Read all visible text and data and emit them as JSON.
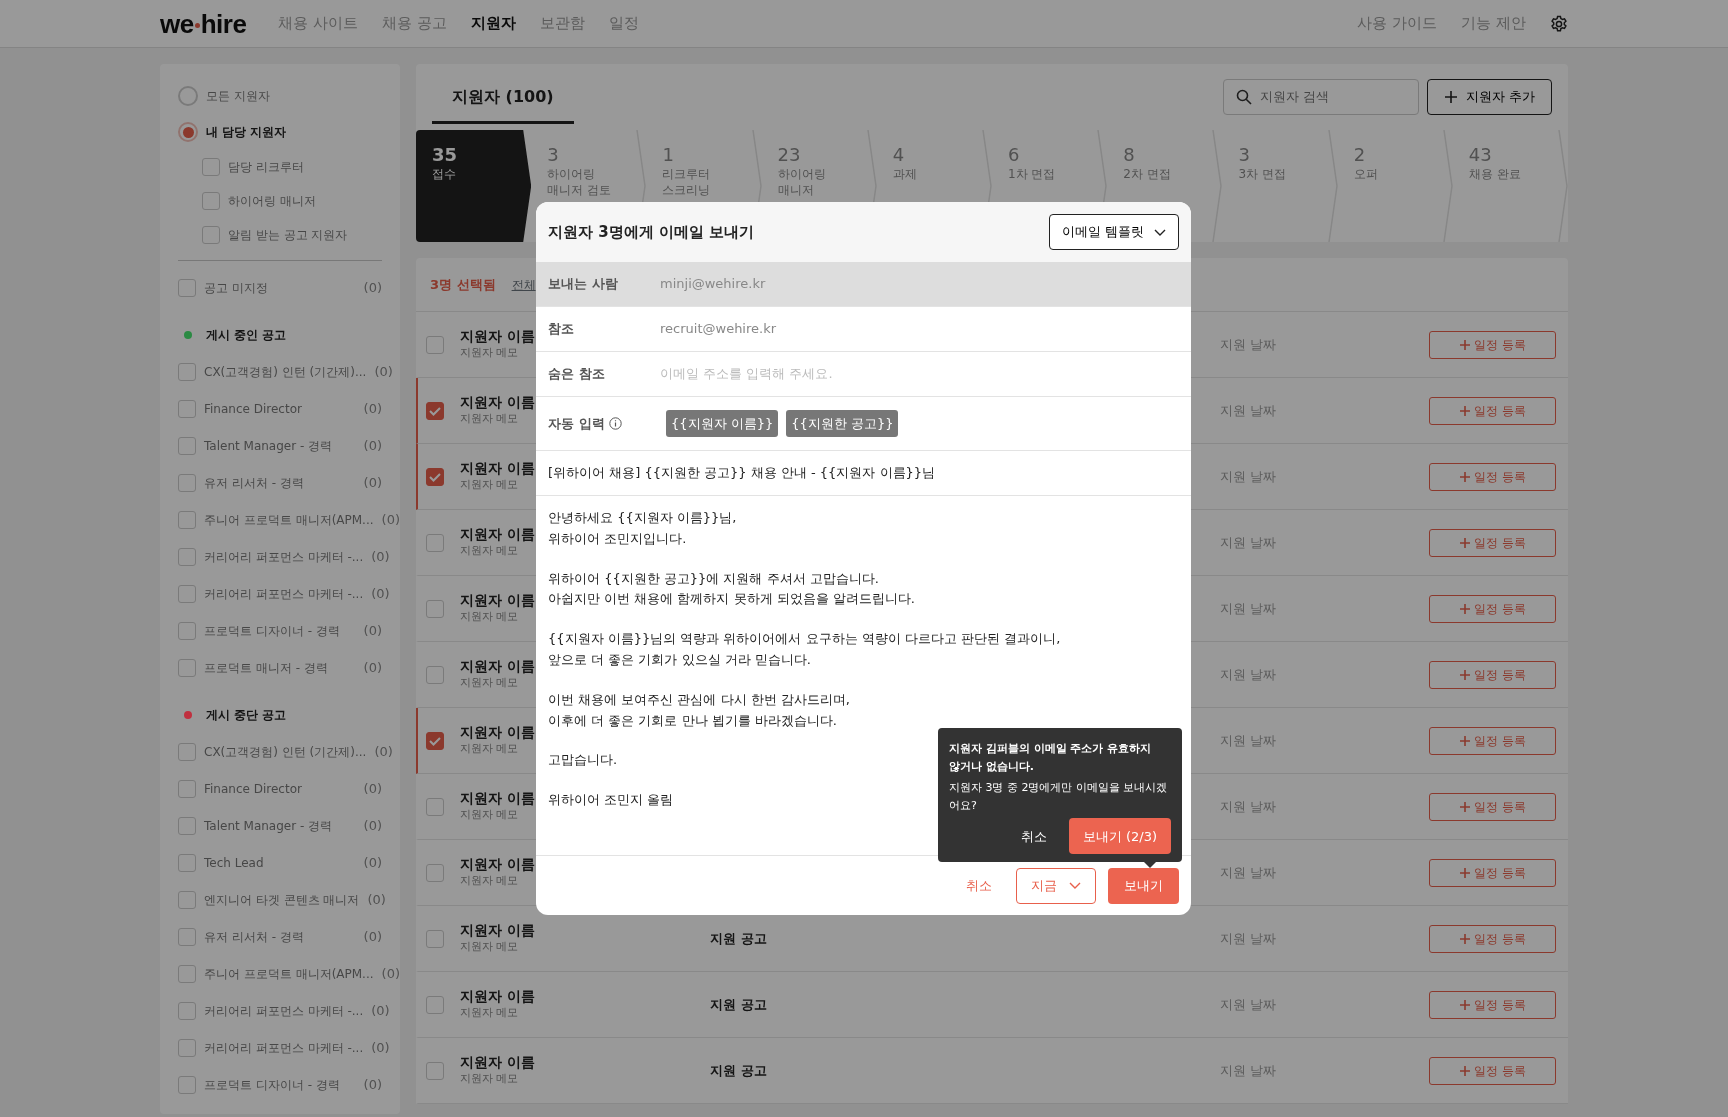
{
  "header": {
    "logo": {
      "before": "we",
      "after": "hire"
    },
    "nav": [
      {
        "label": "채용 사이트",
        "selected": false
      },
      {
        "label": "채용 공고",
        "selected": false
      },
      {
        "label": "지원자",
        "selected": true
      },
      {
        "label": "보관함",
        "selected": false
      },
      {
        "label": "일정",
        "selected": false
      }
    ],
    "links": [
      "사용 가이드",
      "기능 제안"
    ]
  },
  "sidebar": {
    "scopes": [
      {
        "label": "모든 지원자",
        "selected": false
      },
      {
        "label": "내 담당 지원자",
        "selected": true,
        "options": [
          {
            "label": "담당 리크루터",
            "checked": false
          },
          {
            "label": "하이어링 매니저",
            "checked": false
          },
          {
            "label": "알림 받는 공고 지원자",
            "checked": false
          }
        ]
      }
    ],
    "unassigned": {
      "label": "공고 미지정",
      "count": "(0)",
      "checked": false
    },
    "groups": [
      {
        "title": "게시 중인 공고",
        "color": "#2b8a43",
        "items": [
          {
            "label": "CX(고객경험) 인턴 (기간제)...",
            "count": "(0)",
            "checked": false
          },
          {
            "label": "Finance Director",
            "count": "(0)",
            "checked": false
          },
          {
            "label": "Talent Manager - 경력",
            "count": "(0)",
            "checked": false
          },
          {
            "label": "유저 리서처 - 경력",
            "count": "(0)",
            "checked": false
          },
          {
            "label": "주니어 프로덕트 매니저(APM...",
            "count": "(0)",
            "checked": false
          },
          {
            "label": "커리어리 퍼포먼스 마케터 -...",
            "count": "(0)",
            "checked": false
          },
          {
            "label": "커리어리 퍼포먼스 마케터 -...",
            "count": "(0)",
            "checked": false
          },
          {
            "label": "프로덕트 디자이너 - 경력",
            "count": "(0)",
            "checked": false
          },
          {
            "label": "프로덕트 매니저 - 경력",
            "count": "(0)",
            "checked": false
          }
        ]
      },
      {
        "title": "게시 중단 공고",
        "color": "#c0303f",
        "items": [
          {
            "label": "CX(고객경험) 인턴 (기간제)...",
            "count": "(0)",
            "checked": false
          },
          {
            "label": "Finance Director",
            "count": "(0)",
            "checked": false
          },
          {
            "label": "Talent Manager - 경력",
            "count": "(0)",
            "checked": false
          },
          {
            "label": "Tech Lead",
            "count": "(0)",
            "checked": false
          },
          {
            "label": "엔지니어 타겟 콘텐츠 매니저",
            "count": "(0)",
            "checked": false
          },
          {
            "label": "유저 리서처 - 경력",
            "count": "(0)",
            "checked": false
          },
          {
            "label": "주니어 프로덕트 매니저(APM...",
            "count": "(0)",
            "checked": false
          },
          {
            "label": "커리어리 퍼포먼스 마케터 -...",
            "count": "(0)",
            "checked": false
          },
          {
            "label": "커리어리 퍼포먼스 마케터 -...",
            "count": "(0)",
            "checked": false
          },
          {
            "label": "프로덕트 디자이너 - 경력",
            "count": "(0)",
            "checked": false
          }
        ]
      }
    ]
  },
  "main": {
    "tab": {
      "label": "지원자 (100)",
      "selected": true
    },
    "search": {
      "placeholder": "지원자 검색"
    },
    "add_button": "지원자 추가",
    "stages": [
      {
        "count": "35",
        "label": "접수",
        "selected": true
      },
      {
        "count": "3",
        "label": "하이어링 매니저 검토",
        "selected": false
      },
      {
        "count": "1",
        "label": "리크루터 스크리닝",
        "selected": false
      },
      {
        "count": "23",
        "label": "하이어링 매니저",
        "selected": false
      },
      {
        "count": "4",
        "label": "과제",
        "selected": false
      },
      {
        "count": "6",
        "label": "1차 면접",
        "selected": false
      },
      {
        "count": "8",
        "label": "2차 면접",
        "selected": false
      },
      {
        "count": "3",
        "label": "3차 면접",
        "selected": false
      },
      {
        "count": "2",
        "label": "오퍼",
        "selected": false
      },
      {
        "count": "43",
        "label": "채용 완료",
        "selected": false
      }
    ],
    "selection": {
      "count_text": "3명 선택됨",
      "link": "전체"
    },
    "rows": [
      {
        "name": "지원자 이름",
        "memo": "지원자 메모",
        "date": "지원 날짜",
        "action": "일정 등록",
        "checked": false
      },
      {
        "name": "지원자 이름",
        "memo": "지원자 메모",
        "date": "지원 날짜",
        "action": "일정 등록",
        "checked": true
      },
      {
        "name": "지원자 이름",
        "memo": "지원자 메모",
        "date": "지원 날짜",
        "action": "일정 등록",
        "checked": true
      },
      {
        "name": "지원자 이름",
        "memo": "지원자 메모",
        "date": "지원 날짜",
        "action": "일정 등록",
        "checked": false
      },
      {
        "name": "지원자 이름",
        "memo": "지원자 메모",
        "date": "지원 날짜",
        "action": "일정 등록",
        "checked": false
      },
      {
        "name": "지원자 이름",
        "memo": "지원자 메모",
        "date": "지원 날짜",
        "action": "일정 등록",
        "checked": false
      },
      {
        "name": "지원자 이름",
        "memo": "지원자 메모",
        "date": "지원 날짜",
        "action": "일정 등록",
        "checked": true
      },
      {
        "name": "지원자 이름",
        "memo": "지원자 메모",
        "date": "지원 날짜",
        "action": "일정 등록",
        "checked": false
      },
      {
        "name": "지원자 이름",
        "memo": "지원자 메모",
        "date": "지원 날짜",
        "action": "일정 등록",
        "checked": false
      },
      {
        "name": "지원자 이름",
        "memo": "지원자 메모",
        "job": "지원 공고",
        "date": "지원 날짜",
        "action": "일정 등록",
        "checked": false
      },
      {
        "name": "지원자 이름",
        "memo": "지원자 메모",
        "job": "지원 공고",
        "date": "지원 날짜",
        "action": "일정 등록",
        "checked": false
      },
      {
        "name": "지원자 이름",
        "memo": "지원자 메모",
        "job": "지원 공고",
        "date": "지원 날짜",
        "action": "일정 등록",
        "checked": false
      }
    ]
  },
  "modal": {
    "title": "지원자 3명에게 이메일 보내기",
    "template_button": "이메일 템플릿",
    "fields": [
      {
        "label": "보내는 사람",
        "value": "minji@wehire.kr",
        "disabled": true
      },
      {
        "label": "참조",
        "value": "recruit@wehire.kr",
        "disabled": false
      },
      {
        "label": "숨은 참조",
        "placeholder": "이메일 주소를 입력해 주세요.",
        "disabled": false
      }
    ],
    "autofill": {
      "label": "자동 입력",
      "tokens": [
        "{{지원자 이름}}",
        "{{지원한 공고}}"
      ]
    },
    "subject": "[위하이어 채용] {{지원한 공고}} 채용 안내 - {{지원자 이름}}님",
    "body": [
      [
        "안녕하세요 {{지원자 이름}}님,",
        "위하이어 조민지입니다."
      ],
      [
        "위하이어 {{지원한 공고}}에 지원해 주셔서 고맙습니다.",
        "아쉽지만 이번 채용에 함께하지 못하게 되었음을 알려드립니다."
      ],
      [
        "{{지원자 이름}}님의 역량과 위하이어에서 요구하는 역량이 다르다고 판단된 결과이니,",
        "앞으로 더 좋은 기회가 있으실 거라 믿습니다."
      ],
      [
        "이번 채용에 보여주신 관심에 다시 한번 감사드리며,",
        "이후에 더 좋은 기회로 만나 뵙기를 바라겠습니다."
      ],
      [
        "고맙습니다."
      ],
      [
        "위하이어 조민지 올림"
      ]
    ],
    "footer": {
      "cancel": "취소",
      "timing": "지금",
      "send": "보내기"
    },
    "confirm": {
      "title": "지원자 김퍼블의 이메일 주소가 유효하지 않거나 없습니다.",
      "message": "지원자 3명 중 2명에게만 이메일을 보내시겠어요?",
      "cancel": "취소",
      "confirm": "보내기 (2/3)"
    }
  }
}
